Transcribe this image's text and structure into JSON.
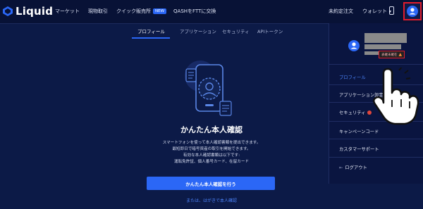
{
  "brand": {
    "name": "Liquid",
    "accent": "#2b67f6"
  },
  "nav": {
    "market": "マーケット",
    "spot": "現物取引",
    "quick": "クイック販売所",
    "new_badge": "NEW",
    "qash": "QASHをFTTに交換"
  },
  "header_right": {
    "pending_orders": "未約定注文",
    "wallet": "ウォレット",
    "wallet_caret": "▾"
  },
  "tabs": [
    "プロフィール",
    "アプリケーション",
    "セキュリティ",
    "APIトークン"
  ],
  "main": {
    "title": "かんたん本人確認",
    "desc_lines": [
      "スマートフォンを使って本人確認書類を提出できます。",
      "最短即日で暗号資産の取引を開始できます。",
      "有効な本人確認書類は以下です:",
      "運転免許証、個人番号カード、在留カード"
    ],
    "cta": "かんたん本人確認を行う",
    "postal": "または、はがきで本人確認"
  },
  "dropdown": {
    "unverified": "表確未確在",
    "items": [
      "プロフィール",
      "アプリケーション設定",
      "セキュリティ",
      "キャンペーンコード",
      "カスタマーサポート",
      "ログアウト"
    ]
  }
}
